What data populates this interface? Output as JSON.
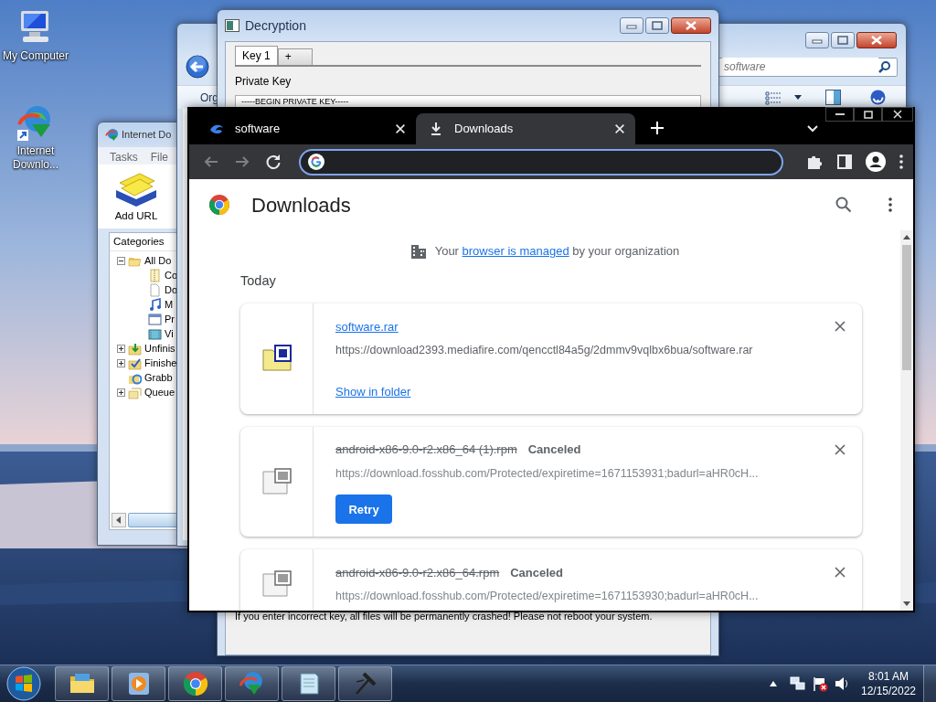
{
  "desktop_icons": [
    {
      "label": "My Computer",
      "kind": "computer"
    },
    {
      "label": "Internet Downlo...",
      "kind": "downloader"
    }
  ],
  "idm_window": {
    "title": "Internet Do",
    "menu": [
      "Tasks",
      "File"
    ],
    "toolbar": [
      {
        "label": "Add URL"
      }
    ],
    "tree_title": "Categories",
    "tree": [
      {
        "label": "All Do",
        "kind": "folder",
        "expanded": true,
        "children": [
          {
            "label": "Co",
            "kind": "archive"
          },
          {
            "label": "Do",
            "kind": "document"
          },
          {
            "label": "M",
            "kind": "music"
          },
          {
            "label": "Pr",
            "kind": "program"
          },
          {
            "label": "Vi",
            "kind": "video"
          }
        ]
      },
      {
        "label": "Unfinis",
        "kind": "unfinished",
        "expanded": false
      },
      {
        "label": "Finishe",
        "kind": "finished",
        "expanded": false
      },
      {
        "label": "Grabb",
        "kind": "grabber"
      },
      {
        "label": "Queue",
        "kind": "queue",
        "expanded": false
      }
    ]
  },
  "explorer_window": {
    "toolbar_label": "Org",
    "search": {
      "placeholder": "software"
    }
  },
  "decryption_window": {
    "title": "Decryption",
    "tabs": [
      {
        "label": "Key 1",
        "selected": true
      },
      {
        "label": "+",
        "selected": false
      }
    ],
    "key_label": "Private Key",
    "key_value": "-----BEGIN PRIVATE KEY-----",
    "warning": "If you enter incorrect key, all files will be permanently crashed! Please not reboot your system."
  },
  "browser": {
    "tabs": [
      {
        "title": "software",
        "kind": "site",
        "selected": false
      },
      {
        "title": "Downloads",
        "kind": "downloads",
        "selected": true
      }
    ],
    "page": {
      "title": "Downloads",
      "notice": {
        "before": "Your ",
        "link": "browser is managed",
        "after": " by your organization"
      },
      "section": "Today",
      "downloads": [
        {
          "name": "software.rar",
          "kind": "archive",
          "canceled": false,
          "url": "https://download2393.mediafire.com/qencctl84a5g/2dmmv9vqlbx6bua/software.rar",
          "action": {
            "kind": "link",
            "label": "Show in folder"
          }
        },
        {
          "name": "android-x86-9.0-r2.x86_64 (1).rpm",
          "kind": "package",
          "canceled": true,
          "status": "Canceled",
          "url": "https://download.fosshub.com/Protected/expiretime=1671153931;badurl=aHR0cH...",
          "action": {
            "kind": "button",
            "label": "Retry"
          }
        },
        {
          "name": "android-x86-9.0-r2.x86_64.rpm",
          "kind": "package",
          "canceled": true,
          "status": "Canceled",
          "url": "https://download.fosshub.com/Protected/expiretime=1671153930;badurl=aHR0cH..."
        }
      ]
    }
  },
  "taskbar": {
    "apps": [
      {
        "kind": "folder"
      },
      {
        "kind": "media"
      },
      {
        "kind": "browser"
      },
      {
        "kind": "downloader"
      },
      {
        "kind": "notepad"
      },
      {
        "kind": "hammer"
      }
    ],
    "clock": {
      "time": "8:01 AM",
      "date": "12/15/2022"
    }
  }
}
